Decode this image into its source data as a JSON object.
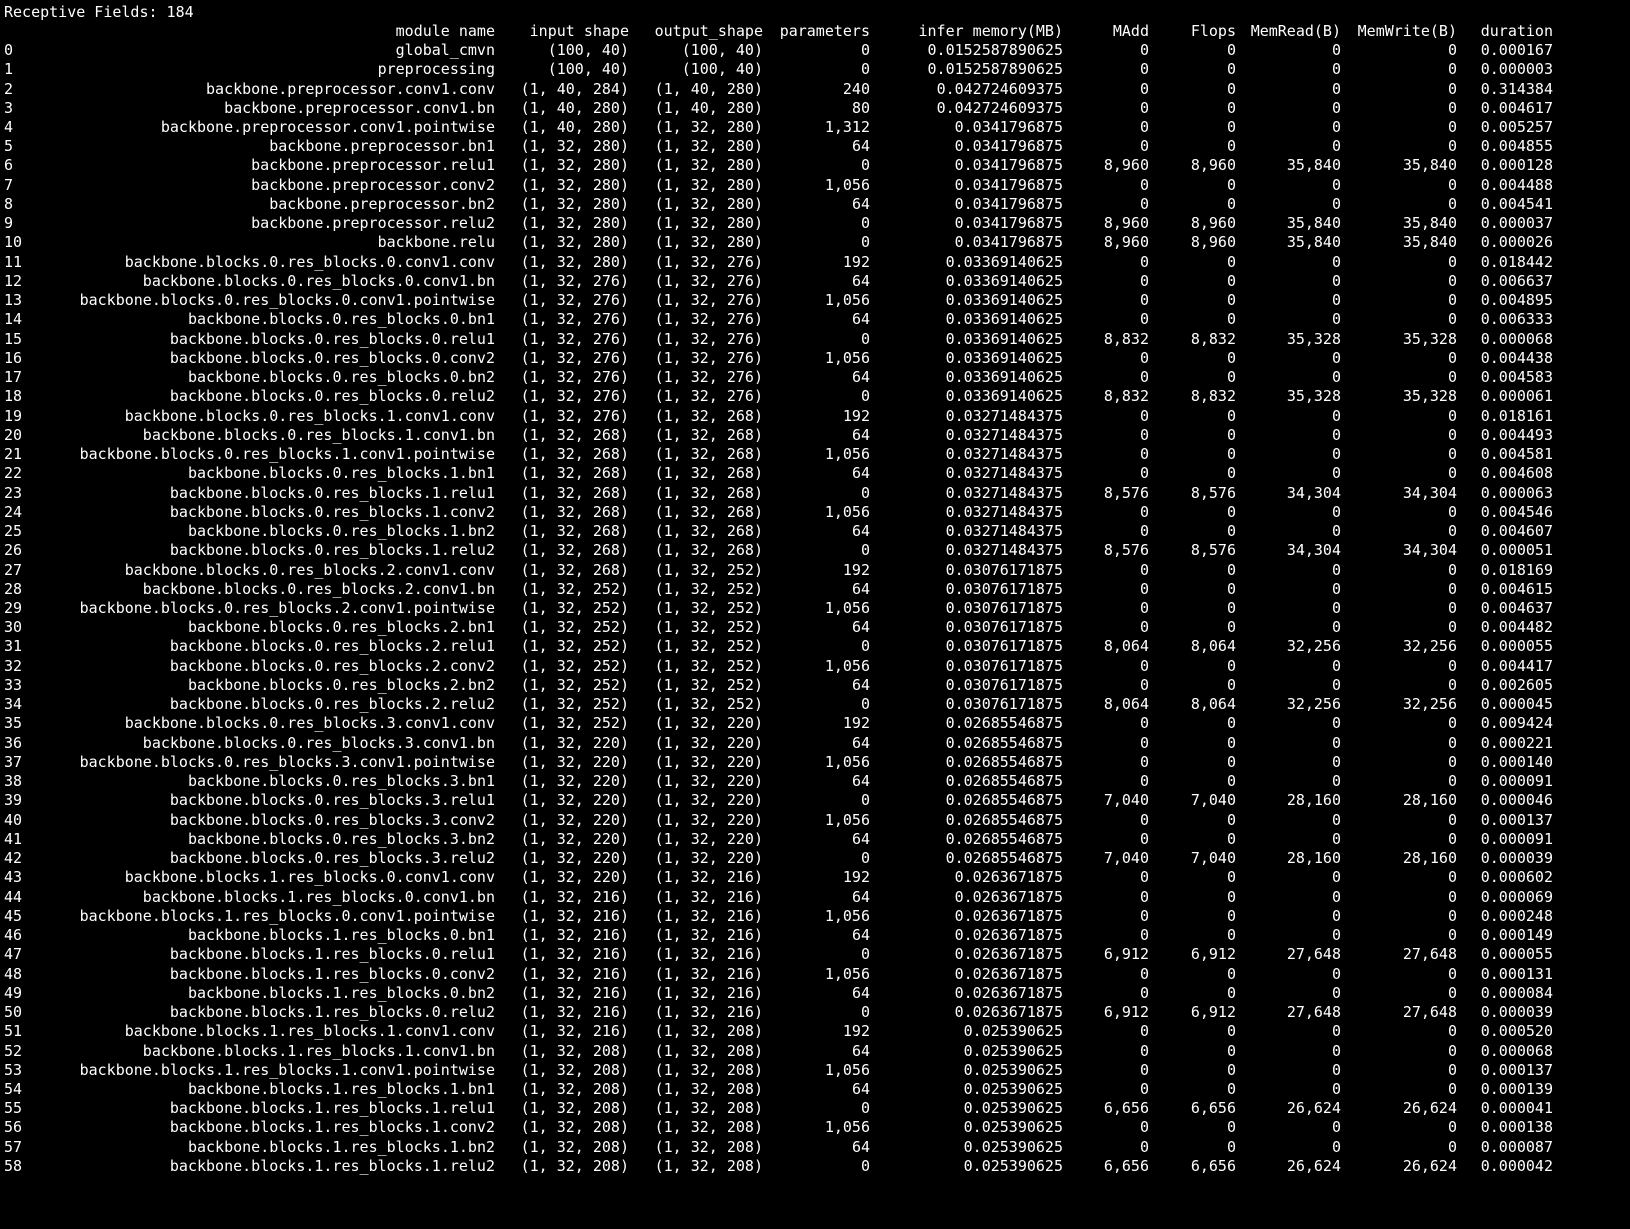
{
  "terminal": {
    "receptive_fields": "Receptive Fields: 184",
    "headers": {
      "module_name": "module name",
      "input_shape": "input shape",
      "output_shape": "output_shape",
      "parameters": "parameters",
      "infer_memory": "infer memory(MB)",
      "madd": "MAdd",
      "flops": "Flops",
      "memread": "MemRead(B)",
      "memwrite": "MemWrite(B)",
      "duration": "duration"
    },
    "rows": [
      [
        "0",
        "global_cmvn",
        "(100, 40)",
        "(100, 40)",
        "0",
        "0.0152587890625",
        "0",
        "0",
        "0",
        "0",
        "0.000167"
      ],
      [
        "1",
        "preprocessing",
        "(100, 40)",
        "(100, 40)",
        "0",
        "0.0152587890625",
        "0",
        "0",
        "0",
        "0",
        "0.000003"
      ],
      [
        "2",
        "backbone.preprocessor.conv1.conv",
        "(1, 40, 284)",
        "(1, 40, 280)",
        "240",
        "0.042724609375",
        "0",
        "0",
        "0",
        "0",
        "0.314384"
      ],
      [
        "3",
        "backbone.preprocessor.conv1.bn",
        "(1, 40, 280)",
        "(1, 40, 280)",
        "80",
        "0.042724609375",
        "0",
        "0",
        "0",
        "0",
        "0.004617"
      ],
      [
        "4",
        "backbone.preprocessor.conv1.pointwise",
        "(1, 40, 280)",
        "(1, 32, 280)",
        "1,312",
        "0.0341796875",
        "0",
        "0",
        "0",
        "0",
        "0.005257"
      ],
      [
        "5",
        "backbone.preprocessor.bn1",
        "(1, 32, 280)",
        "(1, 32, 280)",
        "64",
        "0.0341796875",
        "0",
        "0",
        "0",
        "0",
        "0.004855"
      ],
      [
        "6",
        "backbone.preprocessor.relu1",
        "(1, 32, 280)",
        "(1, 32, 280)",
        "0",
        "0.0341796875",
        "8,960",
        "8,960",
        "35,840",
        "35,840",
        "0.000128"
      ],
      [
        "7",
        "backbone.preprocessor.conv2",
        "(1, 32, 280)",
        "(1, 32, 280)",
        "1,056",
        "0.0341796875",
        "0",
        "0",
        "0",
        "0",
        "0.004488"
      ],
      [
        "8",
        "backbone.preprocessor.bn2",
        "(1, 32, 280)",
        "(1, 32, 280)",
        "64",
        "0.0341796875",
        "0",
        "0",
        "0",
        "0",
        "0.004541"
      ],
      [
        "9",
        "backbone.preprocessor.relu2",
        "(1, 32, 280)",
        "(1, 32, 280)",
        "0",
        "0.0341796875",
        "8,960",
        "8,960",
        "35,840",
        "35,840",
        "0.000037"
      ],
      [
        "10",
        "backbone.relu",
        "(1, 32, 280)",
        "(1, 32, 280)",
        "0",
        "0.0341796875",
        "8,960",
        "8,960",
        "35,840",
        "35,840",
        "0.000026"
      ],
      [
        "11",
        "backbone.blocks.0.res_blocks.0.conv1.conv",
        "(1, 32, 280)",
        "(1, 32, 276)",
        "192",
        "0.03369140625",
        "0",
        "0",
        "0",
        "0",
        "0.018442"
      ],
      [
        "12",
        "backbone.blocks.0.res_blocks.0.conv1.bn",
        "(1, 32, 276)",
        "(1, 32, 276)",
        "64",
        "0.03369140625",
        "0",
        "0",
        "0",
        "0",
        "0.006637"
      ],
      [
        "13",
        "backbone.blocks.0.res_blocks.0.conv1.pointwise",
        "(1, 32, 276)",
        "(1, 32, 276)",
        "1,056",
        "0.03369140625",
        "0",
        "0",
        "0",
        "0",
        "0.004895"
      ],
      [
        "14",
        "backbone.blocks.0.res_blocks.0.bn1",
        "(1, 32, 276)",
        "(1, 32, 276)",
        "64",
        "0.03369140625",
        "0",
        "0",
        "0",
        "0",
        "0.006333"
      ],
      [
        "15",
        "backbone.blocks.0.res_blocks.0.relu1",
        "(1, 32, 276)",
        "(1, 32, 276)",
        "0",
        "0.03369140625",
        "8,832",
        "8,832",
        "35,328",
        "35,328",
        "0.000068"
      ],
      [
        "16",
        "backbone.blocks.0.res_blocks.0.conv2",
        "(1, 32, 276)",
        "(1, 32, 276)",
        "1,056",
        "0.03369140625",
        "0",
        "0",
        "0",
        "0",
        "0.004438"
      ],
      [
        "17",
        "backbone.blocks.0.res_blocks.0.bn2",
        "(1, 32, 276)",
        "(1, 32, 276)",
        "64",
        "0.03369140625",
        "0",
        "0",
        "0",
        "0",
        "0.004583"
      ],
      [
        "18",
        "backbone.blocks.0.res_blocks.0.relu2",
        "(1, 32, 276)",
        "(1, 32, 276)",
        "0",
        "0.03369140625",
        "8,832",
        "8,832",
        "35,328",
        "35,328",
        "0.000061"
      ],
      [
        "19",
        "backbone.blocks.0.res_blocks.1.conv1.conv",
        "(1, 32, 276)",
        "(1, 32, 268)",
        "192",
        "0.03271484375",
        "0",
        "0",
        "0",
        "0",
        "0.018161"
      ],
      [
        "20",
        "backbone.blocks.0.res_blocks.1.conv1.bn",
        "(1, 32, 268)",
        "(1, 32, 268)",
        "64",
        "0.03271484375",
        "0",
        "0",
        "0",
        "0",
        "0.004493"
      ],
      [
        "21",
        "backbone.blocks.0.res_blocks.1.conv1.pointwise",
        "(1, 32, 268)",
        "(1, 32, 268)",
        "1,056",
        "0.03271484375",
        "0",
        "0",
        "0",
        "0",
        "0.004581"
      ],
      [
        "22",
        "backbone.blocks.0.res_blocks.1.bn1",
        "(1, 32, 268)",
        "(1, 32, 268)",
        "64",
        "0.03271484375",
        "0",
        "0",
        "0",
        "0",
        "0.004608"
      ],
      [
        "23",
        "backbone.blocks.0.res_blocks.1.relu1",
        "(1, 32, 268)",
        "(1, 32, 268)",
        "0",
        "0.03271484375",
        "8,576",
        "8,576",
        "34,304",
        "34,304",
        "0.000063"
      ],
      [
        "24",
        "backbone.blocks.0.res_blocks.1.conv2",
        "(1, 32, 268)",
        "(1, 32, 268)",
        "1,056",
        "0.03271484375",
        "0",
        "0",
        "0",
        "0",
        "0.004546"
      ],
      [
        "25",
        "backbone.blocks.0.res_blocks.1.bn2",
        "(1, 32, 268)",
        "(1, 32, 268)",
        "64",
        "0.03271484375",
        "0",
        "0",
        "0",
        "0",
        "0.004607"
      ],
      [
        "26",
        "backbone.blocks.0.res_blocks.1.relu2",
        "(1, 32, 268)",
        "(1, 32, 268)",
        "0",
        "0.03271484375",
        "8,576",
        "8,576",
        "34,304",
        "34,304",
        "0.000051"
      ],
      [
        "27",
        "backbone.blocks.0.res_blocks.2.conv1.conv",
        "(1, 32, 268)",
        "(1, 32, 252)",
        "192",
        "0.03076171875",
        "0",
        "0",
        "0",
        "0",
        "0.018169"
      ],
      [
        "28",
        "backbone.blocks.0.res_blocks.2.conv1.bn",
        "(1, 32, 252)",
        "(1, 32, 252)",
        "64",
        "0.03076171875",
        "0",
        "0",
        "0",
        "0",
        "0.004615"
      ],
      [
        "29",
        "backbone.blocks.0.res_blocks.2.conv1.pointwise",
        "(1, 32, 252)",
        "(1, 32, 252)",
        "1,056",
        "0.03076171875",
        "0",
        "0",
        "0",
        "0",
        "0.004637"
      ],
      [
        "30",
        "backbone.blocks.0.res_blocks.2.bn1",
        "(1, 32, 252)",
        "(1, 32, 252)",
        "64",
        "0.03076171875",
        "0",
        "0",
        "0",
        "0",
        "0.004482"
      ],
      [
        "31",
        "backbone.blocks.0.res_blocks.2.relu1",
        "(1, 32, 252)",
        "(1, 32, 252)",
        "0",
        "0.03076171875",
        "8,064",
        "8,064",
        "32,256",
        "32,256",
        "0.000055"
      ],
      [
        "32",
        "backbone.blocks.0.res_blocks.2.conv2",
        "(1, 32, 252)",
        "(1, 32, 252)",
        "1,056",
        "0.03076171875",
        "0",
        "0",
        "0",
        "0",
        "0.004417"
      ],
      [
        "33",
        "backbone.blocks.0.res_blocks.2.bn2",
        "(1, 32, 252)",
        "(1, 32, 252)",
        "64",
        "0.03076171875",
        "0",
        "0",
        "0",
        "0",
        "0.002605"
      ],
      [
        "34",
        "backbone.blocks.0.res_blocks.2.relu2",
        "(1, 32, 252)",
        "(1, 32, 252)",
        "0",
        "0.03076171875",
        "8,064",
        "8,064",
        "32,256",
        "32,256",
        "0.000045"
      ],
      [
        "35",
        "backbone.blocks.0.res_blocks.3.conv1.conv",
        "(1, 32, 252)",
        "(1, 32, 220)",
        "192",
        "0.02685546875",
        "0",
        "0",
        "0",
        "0",
        "0.009424"
      ],
      [
        "36",
        "backbone.blocks.0.res_blocks.3.conv1.bn",
        "(1, 32, 220)",
        "(1, 32, 220)",
        "64",
        "0.02685546875",
        "0",
        "0",
        "0",
        "0",
        "0.000221"
      ],
      [
        "37",
        "backbone.blocks.0.res_blocks.3.conv1.pointwise",
        "(1, 32, 220)",
        "(1, 32, 220)",
        "1,056",
        "0.02685546875",
        "0",
        "0",
        "0",
        "0",
        "0.000140"
      ],
      [
        "38",
        "backbone.blocks.0.res_blocks.3.bn1",
        "(1, 32, 220)",
        "(1, 32, 220)",
        "64",
        "0.02685546875",
        "0",
        "0",
        "0",
        "0",
        "0.000091"
      ],
      [
        "39",
        "backbone.blocks.0.res_blocks.3.relu1",
        "(1, 32, 220)",
        "(1, 32, 220)",
        "0",
        "0.02685546875",
        "7,040",
        "7,040",
        "28,160",
        "28,160",
        "0.000046"
      ],
      [
        "40",
        "backbone.blocks.0.res_blocks.3.conv2",
        "(1, 32, 220)",
        "(1, 32, 220)",
        "1,056",
        "0.02685546875",
        "0",
        "0",
        "0",
        "0",
        "0.000137"
      ],
      [
        "41",
        "backbone.blocks.0.res_blocks.3.bn2",
        "(1, 32, 220)",
        "(1, 32, 220)",
        "64",
        "0.02685546875",
        "0",
        "0",
        "0",
        "0",
        "0.000091"
      ],
      [
        "42",
        "backbone.blocks.0.res_blocks.3.relu2",
        "(1, 32, 220)",
        "(1, 32, 220)",
        "0",
        "0.02685546875",
        "7,040",
        "7,040",
        "28,160",
        "28,160",
        "0.000039"
      ],
      [
        "43",
        "backbone.blocks.1.res_blocks.0.conv1.conv",
        "(1, 32, 220)",
        "(1, 32, 216)",
        "192",
        "0.0263671875",
        "0",
        "0",
        "0",
        "0",
        "0.000602"
      ],
      [
        "44",
        "backbone.blocks.1.res_blocks.0.conv1.bn",
        "(1, 32, 216)",
        "(1, 32, 216)",
        "64",
        "0.0263671875",
        "0",
        "0",
        "0",
        "0",
        "0.000069"
      ],
      [
        "45",
        "backbone.blocks.1.res_blocks.0.conv1.pointwise",
        "(1, 32, 216)",
        "(1, 32, 216)",
        "1,056",
        "0.0263671875",
        "0",
        "0",
        "0",
        "0",
        "0.000248"
      ],
      [
        "46",
        "backbone.blocks.1.res_blocks.0.bn1",
        "(1, 32, 216)",
        "(1, 32, 216)",
        "64",
        "0.0263671875",
        "0",
        "0",
        "0",
        "0",
        "0.000149"
      ],
      [
        "47",
        "backbone.blocks.1.res_blocks.0.relu1",
        "(1, 32, 216)",
        "(1, 32, 216)",
        "0",
        "0.0263671875",
        "6,912",
        "6,912",
        "27,648",
        "27,648",
        "0.000055"
      ],
      [
        "48",
        "backbone.blocks.1.res_blocks.0.conv2",
        "(1, 32, 216)",
        "(1, 32, 216)",
        "1,056",
        "0.0263671875",
        "0",
        "0",
        "0",
        "0",
        "0.000131"
      ],
      [
        "49",
        "backbone.blocks.1.res_blocks.0.bn2",
        "(1, 32, 216)",
        "(1, 32, 216)",
        "64",
        "0.0263671875",
        "0",
        "0",
        "0",
        "0",
        "0.000084"
      ],
      [
        "50",
        "backbone.blocks.1.res_blocks.0.relu2",
        "(1, 32, 216)",
        "(1, 32, 216)",
        "0",
        "0.0263671875",
        "6,912",
        "6,912",
        "27,648",
        "27,648",
        "0.000039"
      ],
      [
        "51",
        "backbone.blocks.1.res_blocks.1.conv1.conv",
        "(1, 32, 216)",
        "(1, 32, 208)",
        "192",
        "0.025390625",
        "0",
        "0",
        "0",
        "0",
        "0.000520"
      ],
      [
        "52",
        "backbone.blocks.1.res_blocks.1.conv1.bn",
        "(1, 32, 208)",
        "(1, 32, 208)",
        "64",
        "0.025390625",
        "0",
        "0",
        "0",
        "0",
        "0.000068"
      ],
      [
        "53",
        "backbone.blocks.1.res_blocks.1.conv1.pointwise",
        "(1, 32, 208)",
        "(1, 32, 208)",
        "1,056",
        "0.025390625",
        "0",
        "0",
        "0",
        "0",
        "0.000137"
      ],
      [
        "54",
        "backbone.blocks.1.res_blocks.1.bn1",
        "(1, 32, 208)",
        "(1, 32, 208)",
        "64",
        "0.025390625",
        "0",
        "0",
        "0",
        "0",
        "0.000139"
      ],
      [
        "55",
        "backbone.blocks.1.res_blocks.1.relu1",
        "(1, 32, 208)",
        "(1, 32, 208)",
        "0",
        "0.025390625",
        "6,656",
        "6,656",
        "26,624",
        "26,624",
        "0.000041"
      ],
      [
        "56",
        "backbone.blocks.1.res_blocks.1.conv2",
        "(1, 32, 208)",
        "(1, 32, 208)",
        "1,056",
        "0.025390625",
        "0",
        "0",
        "0",
        "0",
        "0.000138"
      ],
      [
        "57",
        "backbone.blocks.1.res_blocks.1.bn2",
        "(1, 32, 208)",
        "(1, 32, 208)",
        "64",
        "0.025390625",
        "0",
        "0",
        "0",
        "0",
        "0.000087"
      ],
      [
        "58",
        "backbone.blocks.1.res_blocks.1.relu2",
        "(1, 32, 208)",
        "(1, 32, 208)",
        "0",
        "0.025390625",
        "6,656",
        "6,656",
        "26,624",
        "26,624",
        "0.000042"
      ]
    ]
  }
}
